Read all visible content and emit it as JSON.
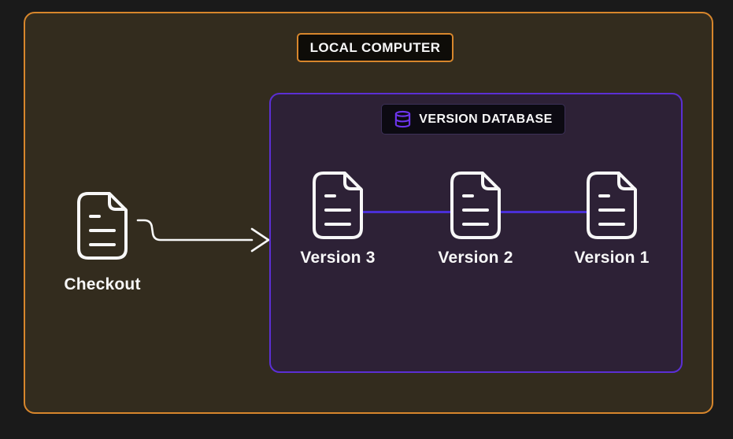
{
  "labels": {
    "outer": "LOCAL COMPUTER",
    "database": "VERSION DATABASE",
    "checkout": "Checkout"
  },
  "versions": [
    {
      "label": "Version 3"
    },
    {
      "label": "Version 2"
    },
    {
      "label": "Version 1"
    }
  ],
  "icons": {
    "file": "file-text-icon",
    "database": "database-icon",
    "arrow": "checkout-arrow-icon"
  },
  "colors": {
    "canvas_bg": "#1a1a1a",
    "outer_bg": "#332c1e",
    "outer_border": "#d7862c",
    "label_bg": "#0e0c08",
    "db_bg": "#2d2136",
    "db_border": "#5b2fd4",
    "db_label_bg": "#0c0a12",
    "db_label_border": "#3b3057",
    "connector": "#4a2fd6",
    "db_icon": "#6d35ee",
    "text": "#f7f7f7"
  }
}
